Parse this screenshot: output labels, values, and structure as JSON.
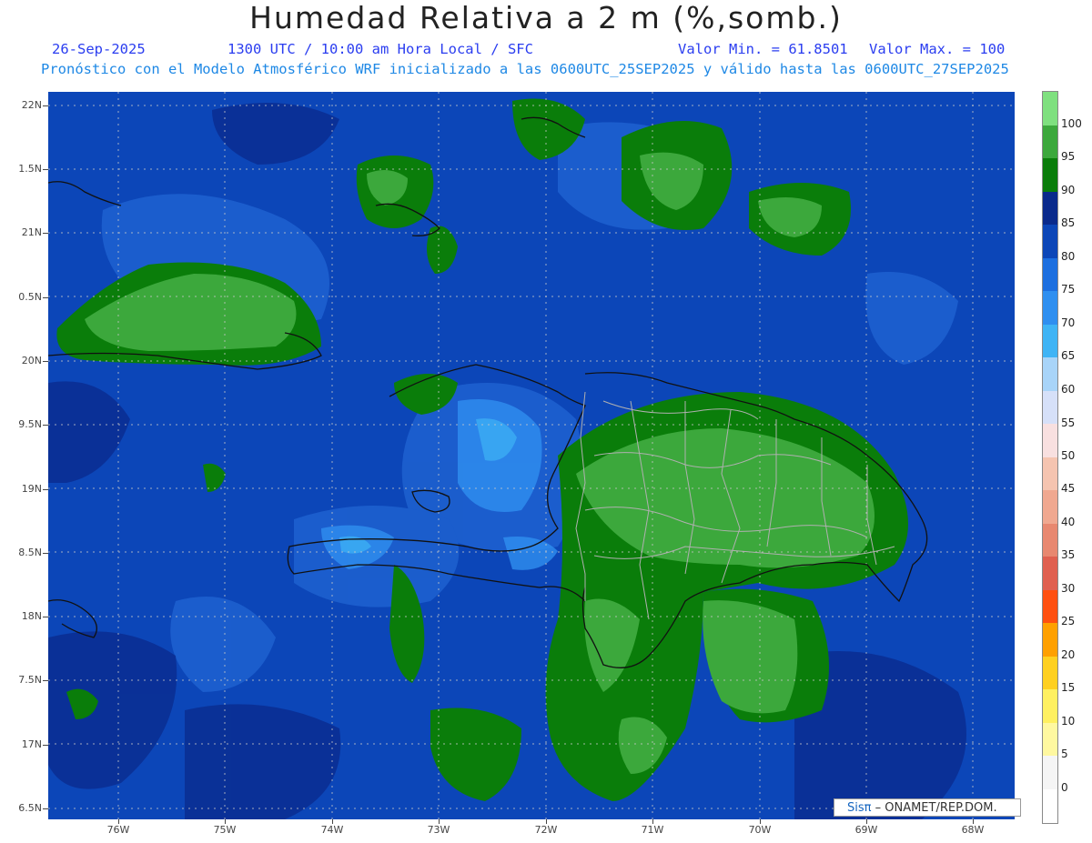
{
  "header": {
    "title": "Humedad Relativa a 2 m (%,somb.)",
    "date": "26-Sep-2025",
    "time": "1300 UTC / 10:00 am Hora Local / SFC",
    "min": "Valor Min. = 61.8501",
    "max": "Valor Max. = 100",
    "model_line": "Pronóstico con el Modelo Atmosférico WRF inicializado a las 0600UTC_25SEP2025 y válido hasta las  0600UTC_27SEP2025"
  },
  "map": {
    "lat_labels": [
      "22N",
      "1.5N",
      "21N",
      "0.5N",
      "20N",
      "9.5N",
      "19N",
      "8.5N",
      "18N",
      "7.5N",
      "17N",
      "6.5N"
    ],
    "lon_labels": [
      "76W",
      "75W",
      "74W",
      "73W",
      "72W",
      "71W",
      "70W",
      "69W",
      "68W"
    ]
  },
  "colorbar": {
    "labels": [
      "100",
      "95",
      "90",
      "85",
      "80",
      "75",
      "70",
      "65",
      "60",
      "55",
      "50",
      "45",
      "40",
      "35",
      "30",
      "25",
      "20",
      "15",
      "10",
      "5",
      "0"
    ],
    "colors": [
      "#7fe07f",
      "#3ca83c",
      "#0a7d0a",
      "#0a2a8c",
      "#0c46b8",
      "#1c6fe0",
      "#2f8ff0",
      "#3fb4f5",
      "#a8d4f8",
      "#d6e0f8",
      "#f8e0e0",
      "#f5c4b0",
      "#f0a890",
      "#e88870",
      "#e06050",
      "#ff5010",
      "#ffa000",
      "#ffd020",
      "#fff060",
      "#fff8a0",
      "#f5f5f5"
    ]
  },
  "credit": {
    "sis": "Sisπ",
    "org": " – ONAMET/REP.DOM."
  }
}
